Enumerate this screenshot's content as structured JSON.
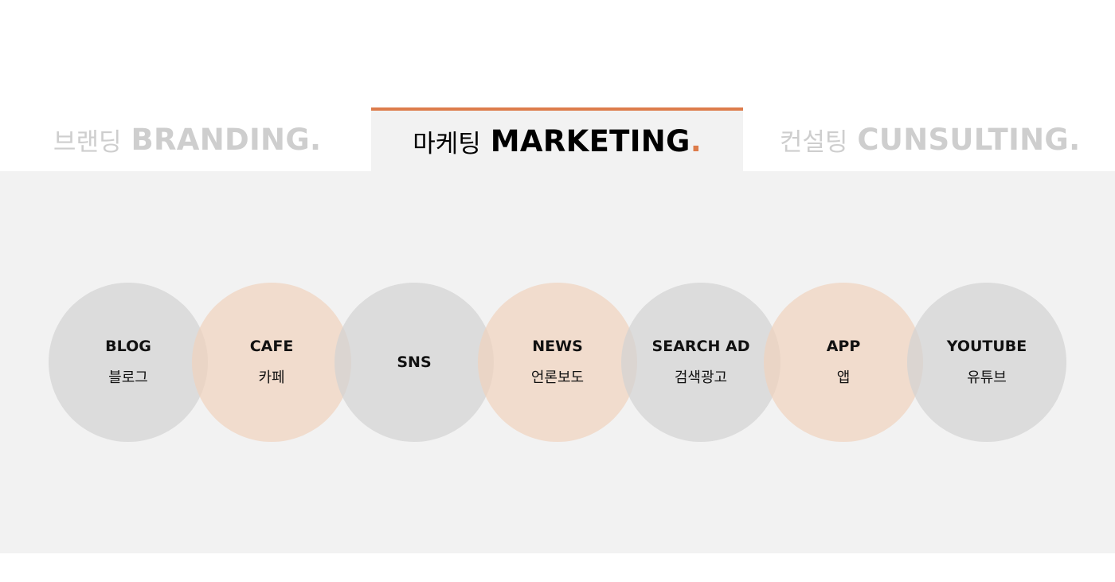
{
  "tabs": [
    {
      "ko": "브랜딩",
      "en": "BRANDING",
      "dot": ".",
      "active": false
    },
    {
      "ko": "마케팅",
      "en": "MARKETING",
      "dot": ".",
      "active": true
    },
    {
      "ko": "컨설팅",
      "en": "CUNSULTING",
      "dot": ".",
      "active": false
    }
  ],
  "colors": {
    "accent": "#dd7c4b",
    "inactive_text": "#cecece",
    "panel_bg": "#f2f2f2",
    "circle_gray": "#d9d9d9",
    "circle_peach": "#f0dbcd"
  },
  "services": [
    {
      "en": "BLOG",
      "ko": "블로그",
      "tone": "gray"
    },
    {
      "en": "CAFE",
      "ko": "카페",
      "tone": "peach"
    },
    {
      "en": "SNS",
      "ko": "",
      "tone": "gray"
    },
    {
      "en": "NEWS",
      "ko": "언론보도",
      "tone": "peach"
    },
    {
      "en": "SEARCH AD",
      "ko": "검색광고",
      "tone": "gray"
    },
    {
      "en": "APP",
      "ko": "앱",
      "tone": "peach"
    },
    {
      "en": "YOUTUBE",
      "ko": "유튜브",
      "tone": "gray"
    }
  ]
}
